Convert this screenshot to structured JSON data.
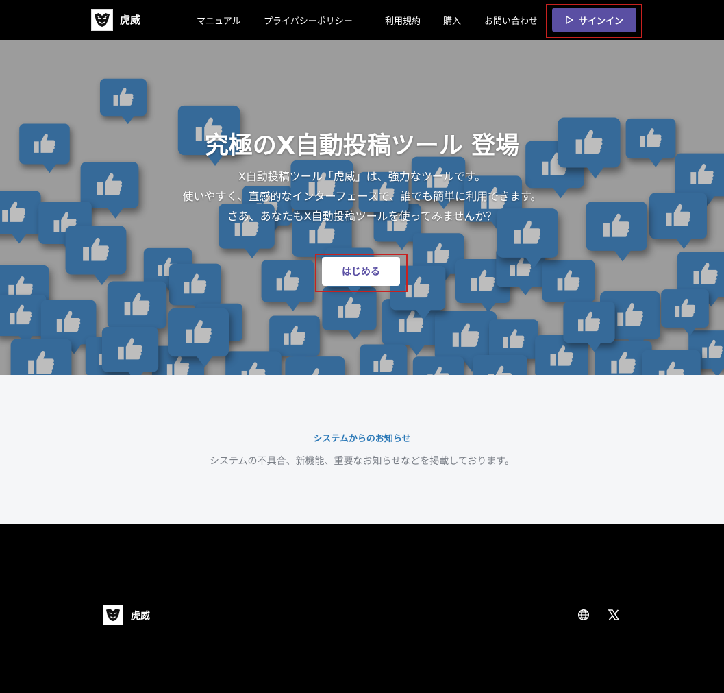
{
  "header": {
    "brand": "虎威",
    "nav": [
      {
        "label": "マニュアル"
      },
      {
        "label": "プライバシーポリシー"
      },
      {
        "label": "利用規約"
      },
      {
        "label": "購入"
      },
      {
        "label": "お問い合わせ"
      }
    ],
    "signin_label": "サインイン"
  },
  "hero": {
    "title": "究極のX自動投稿ツール 登場",
    "lines": [
      "X自動投稿ツール「虎威」は、強力なツールです。",
      "使いやすく、直感的なインターフェースで、誰でも簡単に利用できます。",
      "さあ、あなたもX自動投稿ツールを使ってみませんか？"
    ],
    "start_label": "はじめる"
  },
  "notice": {
    "title": "システムからのお知らせ",
    "description": "システムの不具合、新機能、重要なお知らせなどを掲載しております。"
  },
  "footer": {
    "brand": "虎威",
    "icons": [
      "globe-icon",
      "x-logo-icon"
    ]
  },
  "colors": {
    "accent": "#5a4fa3",
    "notice_title": "#2a78b7",
    "bubble": "#2f6aa0"
  }
}
